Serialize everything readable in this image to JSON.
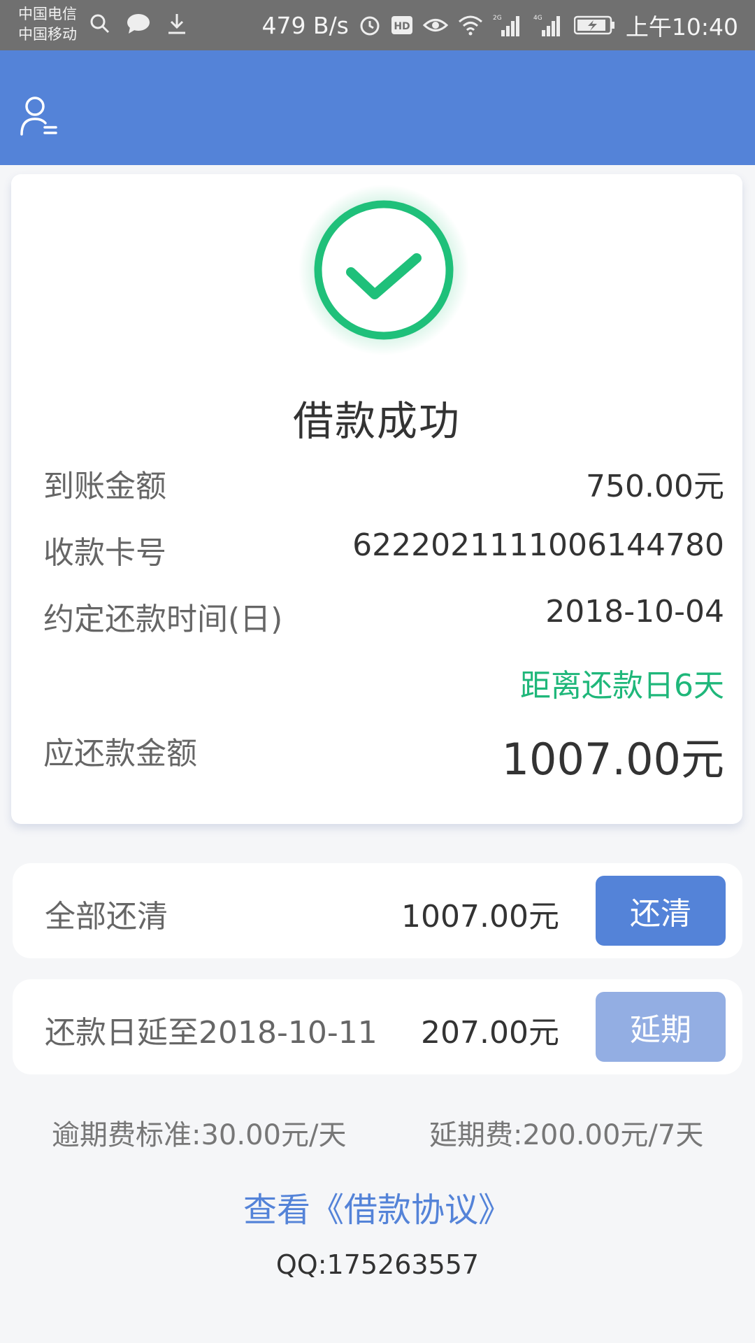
{
  "status_bar": {
    "carrier_1": "中国电信",
    "carrier_2": "中国移动",
    "net_speed": "479 B/s",
    "network_1": "2G",
    "network_2": "4G",
    "time": "上午10:40",
    "icons": [
      "search-icon",
      "chat-icon",
      "download-icon",
      "alarm-icon",
      "hd-icon",
      "eye-icon",
      "wifi-icon",
      "signal-icon",
      "battery-icon"
    ]
  },
  "header": {
    "icon": "user-profile-icon",
    "color": "#5483d8"
  },
  "result": {
    "icon": "success-check-icon",
    "title": "借款成功",
    "rows": [
      {
        "label": "到账金额",
        "value": "750.00元"
      },
      {
        "label": "收款卡号",
        "value": "6222021111006144780"
      },
      {
        "label": "约定还款时间(日)",
        "value": "2018-10-04"
      },
      {
        "label": "",
        "value": "距离还款日6天"
      },
      {
        "label": "应还款金额",
        "value": "1007.00元"
      }
    ]
  },
  "repay_full": {
    "label": "全部还清",
    "amount": "1007.00元",
    "button": "还清"
  },
  "extend": {
    "label": "还款日延至2018-10-11",
    "amount": "207.00元",
    "button": "延期"
  },
  "fees": {
    "overdue": "逾期费标准:30.00元/天",
    "extension": "延期费:200.00元/7天"
  },
  "agreement_link": "查看《借款协议》",
  "contact": "QQ:175263557",
  "colors": {
    "primary": "#5483d8",
    "success": "#1fb77a",
    "disabled_button": "#93aee3"
  }
}
